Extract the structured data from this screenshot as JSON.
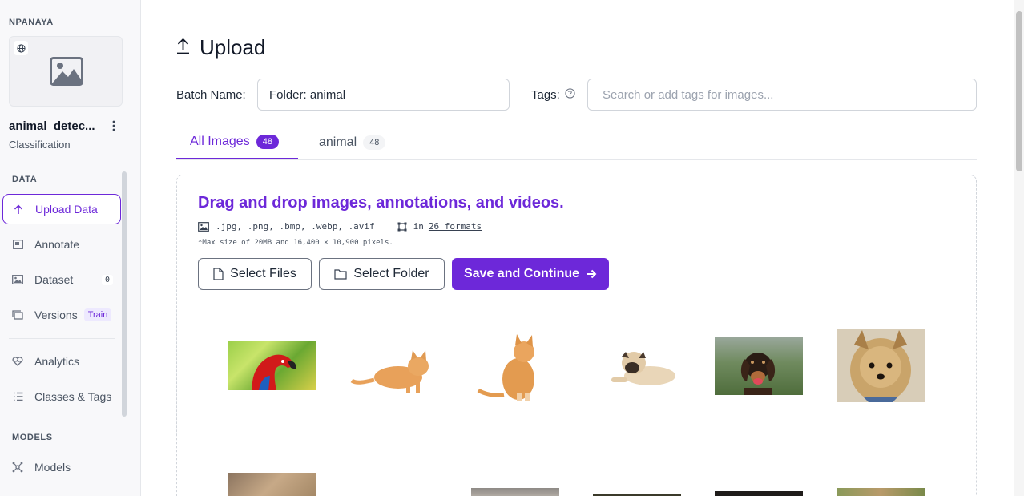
{
  "sidebar": {
    "workspace": "NPANAYA",
    "project": {
      "name": "animal_detec...",
      "type": "Classification"
    },
    "sections": {
      "data": "DATA",
      "models": "MODELS"
    },
    "items": [
      {
        "label": "Upload Data",
        "icon": "upload-icon",
        "active": true
      },
      {
        "label": "Annotate",
        "icon": "annotate-icon"
      },
      {
        "label": "Dataset",
        "icon": "dataset-icon",
        "count": "0"
      },
      {
        "label": "Versions",
        "icon": "versions-icon",
        "badge": "Train"
      },
      {
        "label": "Analytics",
        "icon": "analytics-icon"
      },
      {
        "label": "Classes & Tags",
        "icon": "classes-icon"
      },
      {
        "label": "Models",
        "icon": "models-icon"
      }
    ]
  },
  "header": {
    "title": "Upload"
  },
  "form": {
    "batch_label": "Batch Name:",
    "batch_value": "Folder: animal",
    "tags_label": "Tags:",
    "tags_placeholder": "Search or add tags for images..."
  },
  "tabs": [
    {
      "label": "All Images",
      "count": "48"
    },
    {
      "label": "animal",
      "count": "48"
    }
  ],
  "dropzone": {
    "title": "Drag and drop images, annotations, and videos.",
    "image_formats": ".jpg, .png, .bmp, .webp, .avif",
    "annotation_prefix": "in",
    "annotation_formats_link": "26 formats",
    "note": "*Max size of 20MB and 16,400 × 10,900 pixels.",
    "select_files": "Select Files",
    "select_folder": "Select Folder",
    "save_continue": "Save and Continue"
  },
  "colors": {
    "accent": "#6d28d9"
  }
}
